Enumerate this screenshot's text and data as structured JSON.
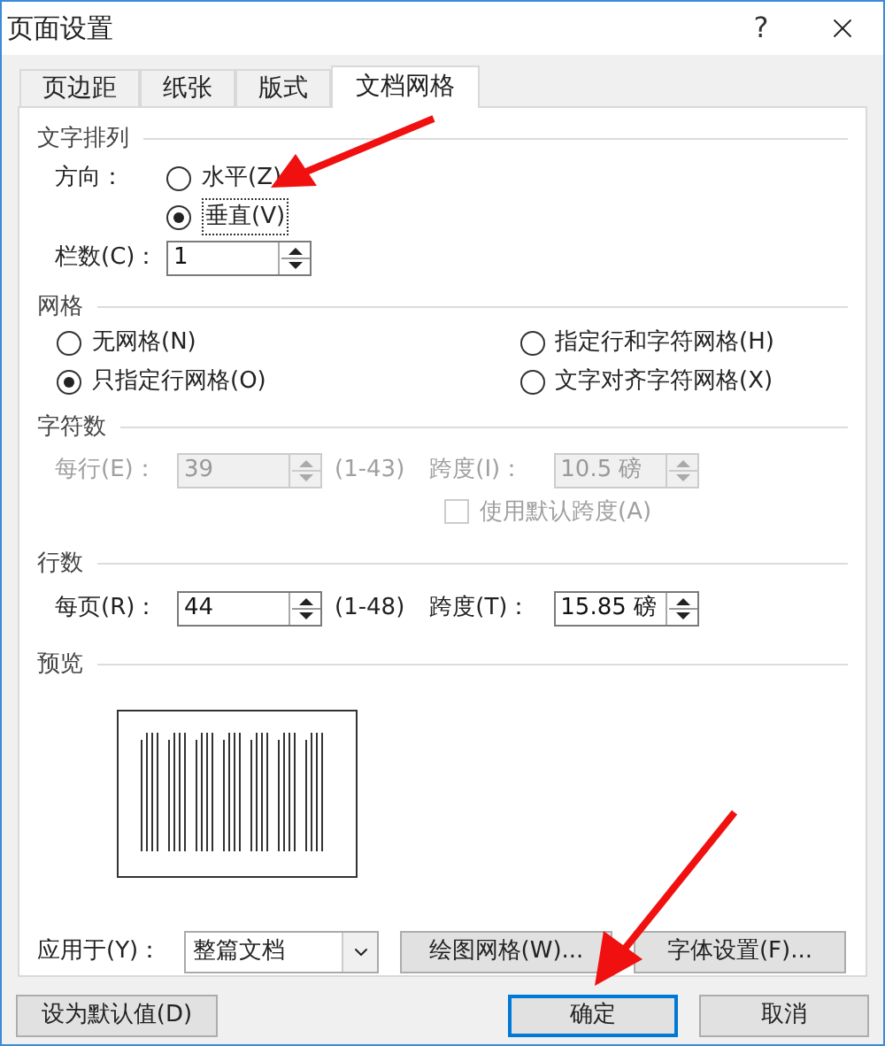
{
  "window": {
    "title": "页面设置",
    "help": "?"
  },
  "tabs": [
    {
      "label": "页边距",
      "selected": false
    },
    {
      "label": "纸张",
      "selected": false
    },
    {
      "label": "版式",
      "selected": false
    },
    {
      "label": "文档网格",
      "selected": true
    }
  ],
  "text_direction": {
    "heading": "文字排列",
    "label": "方向：",
    "options": [
      {
        "label": "水平(Z)",
        "selected": false
      },
      {
        "label": "垂直(V)",
        "selected": true
      }
    ],
    "columns_label": "栏数(C)：",
    "columns_value": "1"
  },
  "grid": {
    "heading": "网格",
    "options": [
      {
        "label": "无网格(N)",
        "selected": false
      },
      {
        "label": "指定行和字符网格(H)",
        "selected": false
      },
      {
        "label": "只指定行网格(O)",
        "selected": true
      },
      {
        "label": "文字对齐字符网格(X)",
        "selected": false
      }
    ]
  },
  "characters": {
    "heading": "字符数",
    "disabled": true,
    "per_line_label": "每行(E)：",
    "per_line_value": "39",
    "range": "(1-43)",
    "pitch_label": "跨度(I)：",
    "pitch_value": "10.5 磅",
    "default_pitch": {
      "label": "使用默认跨度(A)",
      "checked": false
    }
  },
  "lines": {
    "heading": "行数",
    "disabled": false,
    "per_page_label": "每页(R)：",
    "per_page_value": "44",
    "range": "(1-48)",
    "pitch_label": "跨度(T)：",
    "pitch_value": "15.85 磅"
  },
  "preview": {
    "heading": "预览"
  },
  "apply_to": {
    "label": "应用于(Y)：",
    "value": "整篇文档"
  },
  "buttons": [
    {
      "label": "绘图网格(W)..."
    },
    {
      "label": "字体设置(F)..."
    }
  ],
  "footer": {
    "default_button": "设为默认值(D)",
    "ok": "确定",
    "cancel": "取消"
  }
}
